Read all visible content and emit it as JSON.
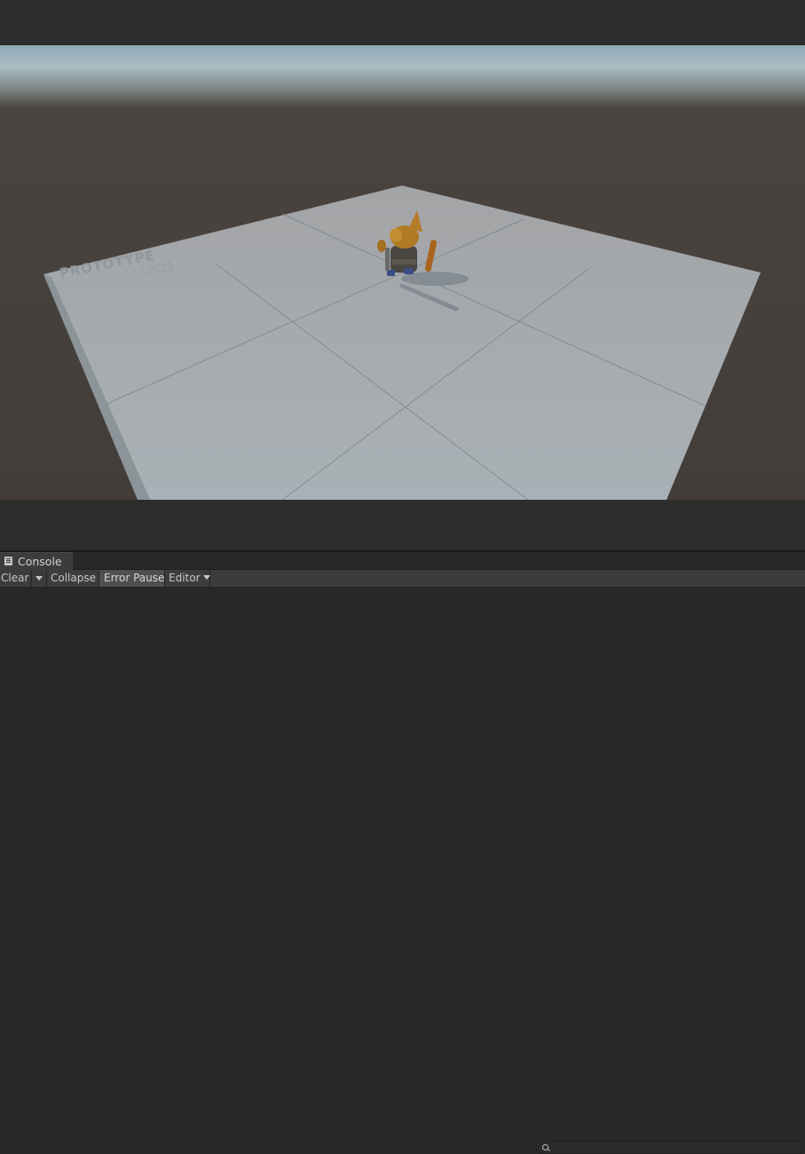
{
  "game_view": {
    "ground_texture": {
      "title": "PROTOTYPE",
      "line1": "1 × 1 METER",
      "line2": "TILE GRID"
    }
  },
  "console": {
    "tab_label": "Console",
    "toolbar": {
      "clear_label": "Clear",
      "collapse_label": "Collapse",
      "error_pause_label": "Error Pause",
      "editor_label": "Editor"
    },
    "search": {
      "value": "",
      "placeholder": ""
    }
  },
  "colors": {
    "editor_bg": "#282828",
    "toolbar_bg": "#3c3c3c",
    "ground_plane": "#a9b0b4",
    "horizon_ground": "#403a37"
  }
}
